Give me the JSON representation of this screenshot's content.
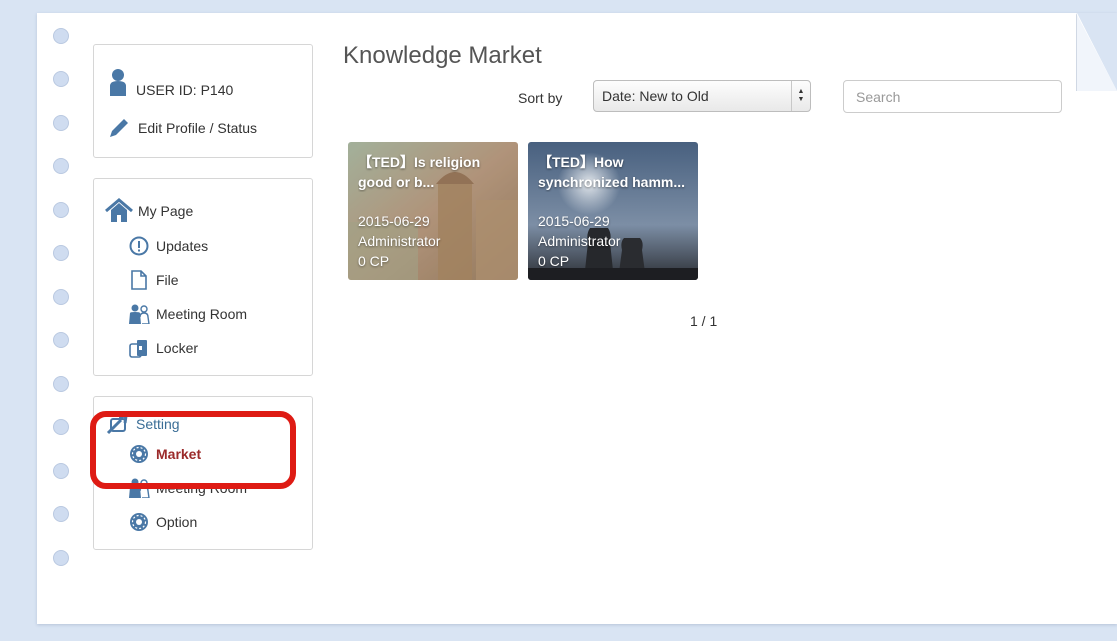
{
  "user": {
    "id_label": "USER ID: P140",
    "edit_label": "Edit Profile / Status"
  },
  "mypage": {
    "heading": "My Page",
    "items": [
      {
        "label": "Updates",
        "icon": "exclamation-circle-icon"
      },
      {
        "label": "File",
        "icon": "file-icon"
      },
      {
        "label": "Meeting Room",
        "icon": "people-icon"
      },
      {
        "label": "Locker",
        "icon": "locker-icon"
      }
    ]
  },
  "setting": {
    "heading": "Setting",
    "items": [
      {
        "label": "Market",
        "icon": "gear-icon",
        "active": true
      },
      {
        "label": "Meeting Room",
        "icon": "people-icon"
      },
      {
        "label": "Option",
        "icon": "gear-icon"
      }
    ]
  },
  "main": {
    "title": "Knowledge Market",
    "sort_label": "Sort by",
    "sort_value": "Date: New to Old",
    "search_placeholder": "Search",
    "pager": "1 / 1"
  },
  "cards": [
    {
      "title": "【TED】Is religion good or b...",
      "date": "2015-06-29",
      "author": "Administrator",
      "points": "0 CP"
    },
    {
      "title": "【TED】How synchronized hamm...",
      "date": "2015-06-29",
      "author": "Administrator",
      "points": "0 CP"
    }
  ],
  "colors": {
    "accent": "#3a7bbf",
    "icon": "#4a78a6",
    "active_text": "#9b2a2a",
    "highlight": "#de1b14",
    "background": "#d9e4f3"
  }
}
